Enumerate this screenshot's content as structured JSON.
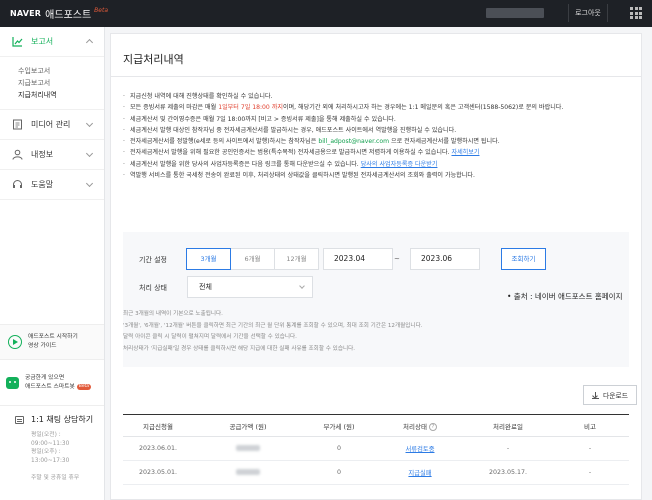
{
  "header": {
    "brand": "NAVER",
    "product": "애드포스트",
    "beta": "Beta",
    "logout": "로그아웃"
  },
  "sidebar": {
    "menu": [
      {
        "label": "보고서",
        "icon": "chart-icon",
        "active": true,
        "children": [
          "수입보고서",
          "지급보고서",
          "지급처리내역"
        ]
      },
      {
        "label": "미디어 관리",
        "icon": "document-icon"
      },
      {
        "label": "내정보",
        "icon": "user-icon"
      },
      {
        "label": "도움말",
        "icon": "headset-icon"
      }
    ],
    "promo_guide": {
      "line1": "애드포스트 시작하기",
      "line2": "영상 가이드"
    },
    "promo_store": {
      "line1": "궁금한게 있으면",
      "line2": "애드포스트 스마트봇",
      "badge": "Beta"
    },
    "chat": {
      "title": "1:1 채팅 상담하기",
      "hours": [
        "평일(오전) :",
        "09:00~11:30",
        "평일(오후) :",
        "13:00~17:30"
      ],
      "holiday": "주말 및 공휴일 휴무"
    }
  },
  "main": {
    "title": "지급처리내역",
    "notes": {
      "n1": "지급신청 내역에 대해 진행상태를 확인하실 수 있습니다.",
      "n2a": "모든 증빙서류 제출의 마감은 매월 ",
      "n2b": "1일부터 7일 18:00 까지",
      "n2c": "이며, 해당기간 외에 처리하시고자 하는 경우에는 1:1 메일문의 혹은 고객센터(1588-5062)로 문의 바랍니다.",
      "n3": "세금계산서 및 간이영수증은 매월 7일 18:00까지 [비고 > 증빙서류 제출]을 통해 제출하실 수 있습니다.",
      "n4": "세금계산서 발행 대상인 참작자님 중 전자세금계산서를 발급하시는 경우, 애드포스트 사이트에서 역발행을 진행하실 수 있습니다.",
      "n5a": "전자세금계산서를 정발행(e세로 등의 사이트에서 발행)하시는 참작자님은 ",
      "n5b": "bill_adpost@naver.com",
      "n5c": " 으로 전자세금계산서를 발행하시면 됩니다.",
      "n6a": "전자세금계산서 발행을 위해 필요한 공인인증서는 범용(특수목적) 전자세금용으로 발급하시면 저렴하게 이용하실 수 있습니다. ",
      "n6b": "자세히보기",
      "n7a": "세금계산서 발행을 위한 당사의 사업자등록증은 다음 링크를 통해 다운받으실 수 있습니다. ",
      "n7b": "당사의 사업자등록증 다운받기",
      "n8": "역발행 서비스를 통한 국세청 전송이 완료된 이후, 처리상태의 상태값을 클릭하시면 발행된 전자세금계산서의 조회와 출력이 가능합니다."
    },
    "filter": {
      "period_label": "기간 설정",
      "periods": [
        "3개월",
        "6개월",
        "12개월"
      ],
      "start": "2023.04",
      "tilde": "~",
      "end": "2023.06",
      "search": "조회하기",
      "status_label": "처리 상태",
      "status_value": "전체",
      "source": "• 출처 : 네이버 애드포스트 홈페이지",
      "notes": [
        "최근 3개월의 내역이 기본으로 노출됩니다.",
        "'3개월', '6개월', '12개월' 버튼을 클릭하면 최근 기간의 최근 월 단위 통계를 조회할 수 있으며, 최대 조회 기간은 12개월입니다.",
        "달력 아이콘 클릭 시 달력이 펼쳐지며 달력에서 기간을 선택할 수 있습니다.",
        "처리상태가 '지급실패'일 경우 상태를 클릭하시면 해당 지급에 대한 실패 사유를 조회할 수 있습니다."
      ]
    },
    "download": "다운로드",
    "table": {
      "headers": [
        "지급신청월",
        "공급가액 (원)",
        "부가세 (원)",
        "처리상태",
        "처리완료일",
        "비고"
      ],
      "rows": [
        {
          "month": "2023.06.01.",
          "vat": "0",
          "status": "서류검토중",
          "done": "-",
          "note": "-"
        },
        {
          "month": "2023.05.01.",
          "vat": "0",
          "status": "지급실패",
          "done": "2023.05.17.",
          "note": "-"
        }
      ]
    }
  }
}
